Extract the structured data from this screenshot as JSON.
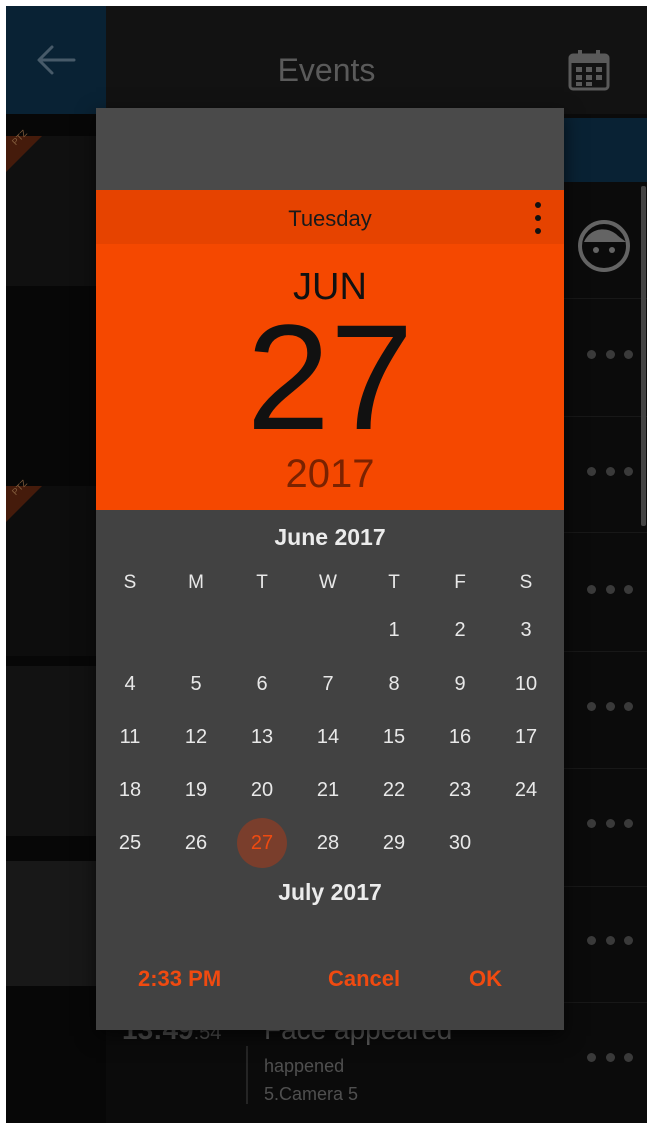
{
  "appbar": {
    "title": "Events",
    "back_icon": "arrow-left-icon",
    "calendar_icon": "calendar-icon"
  },
  "face_filter_icon": "face-icon",
  "thumbnails": {
    "badge_text": "PTZ"
  },
  "last_row": {
    "time_main": "13:49",
    "time_seconds": ":54",
    "title": "Face appeared",
    "subtitle": "happened",
    "camera": "5.Camera 5"
  },
  "date_picker": {
    "weekday": "Tuesday",
    "month_short": "JUN",
    "day": "27",
    "year": "2017",
    "month_title": "June 2017",
    "weekday_initials": [
      "S",
      "M",
      "T",
      "W",
      "T",
      "F",
      "S"
    ],
    "days": [
      [
        "",
        "",
        "",
        "",
        "1",
        "2",
        "3"
      ],
      [
        "4",
        "5",
        "6",
        "7",
        "8",
        "9",
        "10"
      ],
      [
        "11",
        "12",
        "13",
        "14",
        "15",
        "16",
        "17"
      ],
      [
        "18",
        "19",
        "20",
        "21",
        "22",
        "23",
        "24"
      ],
      [
        "25",
        "26",
        "27",
        "28",
        "29",
        "30",
        ""
      ]
    ],
    "selected_day": "27",
    "next_month_title": "July 2017",
    "time_label": "2:33 PM",
    "cancel_label": "Cancel",
    "ok_label": "OK"
  },
  "colors": {
    "accent": "#f54800",
    "accent_text": "#f04a10",
    "dialog_bg": "#424242",
    "appbar_blue": "#0f3550"
  }
}
